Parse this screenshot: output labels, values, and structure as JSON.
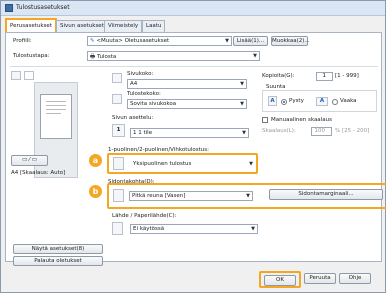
{
  "window": {
    "title": "Tulostusasetukset"
  },
  "tabs": [
    "Perusasetukset",
    "Sivun asetukset",
    "Viimeistely",
    "Laatu"
  ],
  "profile": {
    "label": "Profiili:",
    "value": "<Muuta> Oletusasetukset",
    "add": "Lisää(1)...",
    "edit": "Muokkaa(2)..."
  },
  "output": {
    "label": "Tulostustapa:",
    "value": "Tulosta"
  },
  "page_size": {
    "label": "Sivukoko:",
    "value": "A4"
  },
  "output_size": {
    "label": "Tulostekoko:",
    "value": "Sovita sivukokoa"
  },
  "copies": {
    "label": "Kopioita(G):",
    "value": "1",
    "range": "[1 - 999]"
  },
  "orientation": {
    "label": "Suunta",
    "portrait": "Pysty",
    "landscape": "Vaaka",
    "portrait_icon": "A",
    "landscape_icon": "A"
  },
  "layout": {
    "label": "Sivun asettelu:",
    "value": "1 1 tile"
  },
  "manual_scaling": {
    "label": "Manuaalinen skaalaus",
    "scale_label": "Skaalaus(L):",
    "value": "100",
    "range": "% [25 - 200]"
  },
  "duplex": {
    "label": "1-puolinen/2-puolinen/Vihkotulostus:",
    "value": "Yksipuolinen tulostus",
    "marker": "a"
  },
  "binding": {
    "label": "Sidontakohta(D):",
    "value": "Pitkä reuna [Vasen]",
    "marker": "b",
    "margin_btn": "Sidontamarginaali..."
  },
  "paper_source": {
    "label": "Lähde / Paperilähde(C):",
    "value": "Ei käytössä"
  },
  "preview": {
    "caption": "A4 [Skaalaus: Auto]"
  },
  "left_buttons": {
    "view": "Näytä asetukset(8)",
    "restore": "Palauta oletukset"
  },
  "footer": {
    "ok": "OK",
    "cancel": "Peruuta",
    "help": "Ohje"
  }
}
